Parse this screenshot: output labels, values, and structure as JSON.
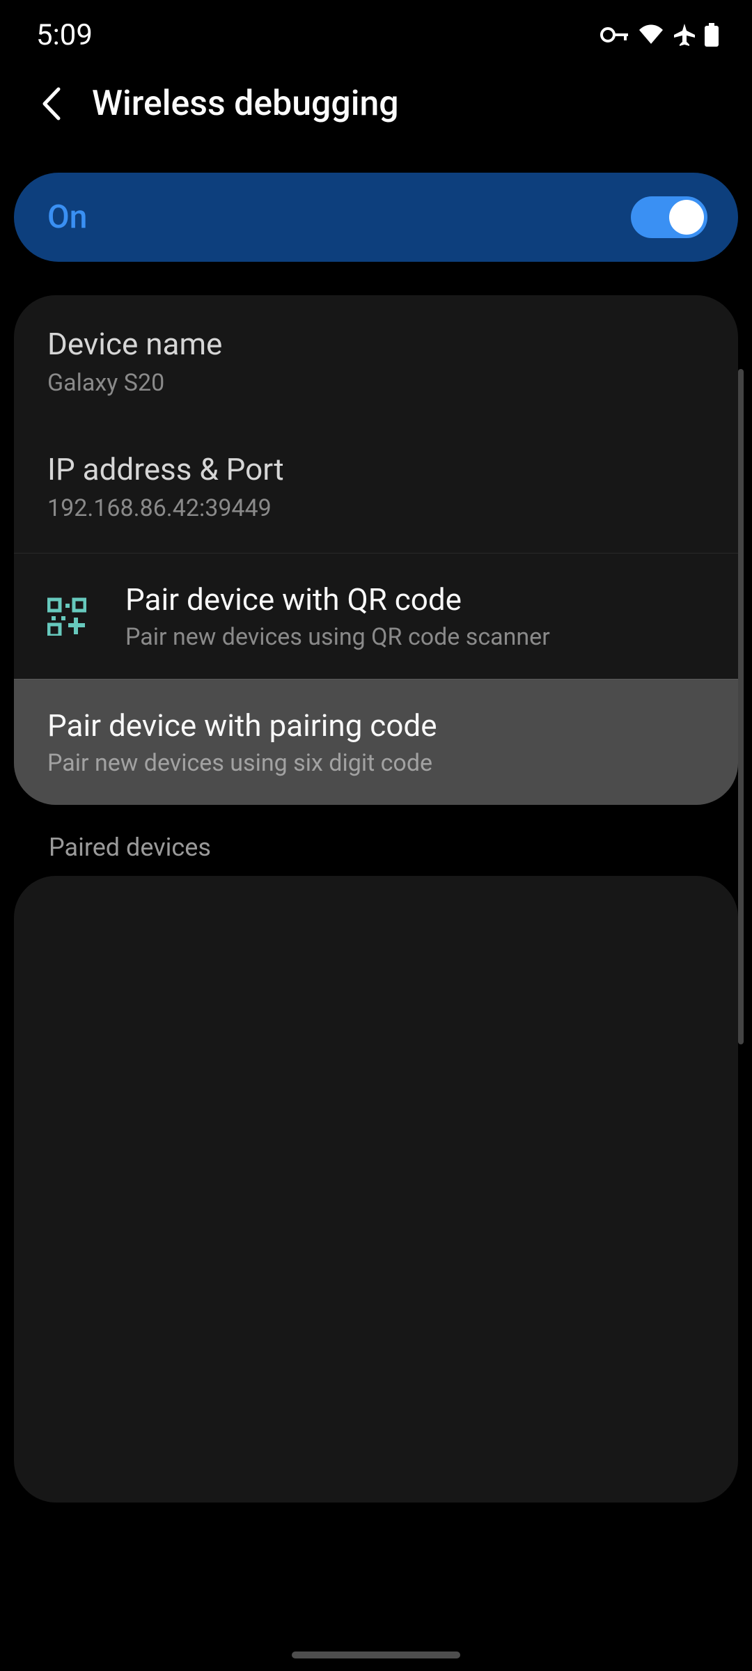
{
  "statusbar": {
    "time": "5:09"
  },
  "header": {
    "title": "Wireless debugging"
  },
  "toggle": {
    "label": "On",
    "state": "on"
  },
  "info": {
    "device_name_label": "Device name",
    "device_name_value": "Galaxy S20",
    "ip_port_label": "IP address & Port",
    "ip_port_value": "192.168.86.42:39449"
  },
  "pair": {
    "qr": {
      "title": "Pair device with QR code",
      "sub": "Pair new devices using QR code scanner"
    },
    "code": {
      "title": "Pair device with pairing code",
      "sub": "Pair new devices using six digit code"
    }
  },
  "sections": {
    "paired_devices": "Paired devices"
  }
}
